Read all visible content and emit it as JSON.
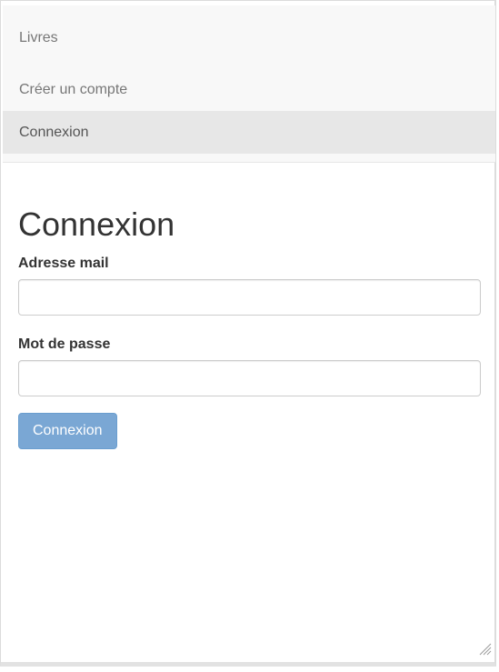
{
  "navbar": {
    "items": [
      {
        "label": "Livres"
      },
      {
        "label": "Créer un compte"
      },
      {
        "label": "Connexion",
        "active": true
      }
    ]
  },
  "main": {
    "title": "Connexion",
    "email_label": "Adresse mail",
    "email_value": "",
    "password_label": "Mot de passe",
    "password_value": "",
    "submit_label": "Connexion"
  },
  "colors": {
    "navbar_bg": "#f8f8f8",
    "active_item_bg": "#e7e7e7",
    "button_bg": "#7aa7d4"
  },
  "icons": {
    "resize_grip": "resize-grip-icon"
  }
}
